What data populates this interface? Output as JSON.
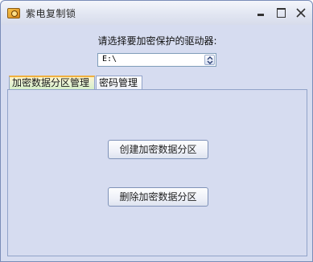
{
  "window": {
    "title": "紫电复制锁"
  },
  "icons": {
    "app": "lock-app-icon",
    "minimize": "minimize-icon",
    "maximize": "maximize-icon",
    "close": "close-icon",
    "dropdown": "chevron-updown-icon"
  },
  "drive": {
    "prompt": "请选择要加密保护的驱动器:",
    "selected": "E:\\"
  },
  "tabs": [
    {
      "label": "加密数据分区管理",
      "active": true
    },
    {
      "label": "密码管理",
      "active": false
    }
  ],
  "buttons": {
    "create": "创建加密数据分区",
    "delete": "删除加密数据分区"
  },
  "colors": {
    "window_bg": "#d6dcf0",
    "active_tab_accent": "#f0b040"
  }
}
